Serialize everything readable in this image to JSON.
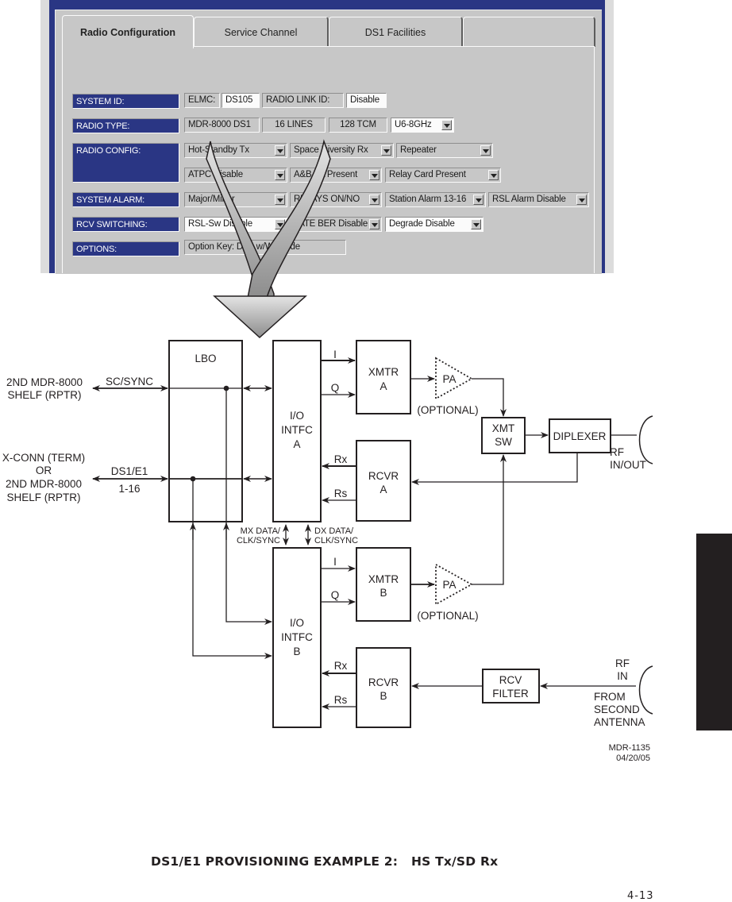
{
  "screenshot": {
    "tabs": [
      {
        "label": "Radio Configuration",
        "active": true
      },
      {
        "label": "Service Channel",
        "active": false
      },
      {
        "label": "DS1 Facilities",
        "active": false
      },
      {
        "label": "",
        "active": false
      }
    ],
    "rows": {
      "system_id": {
        "label": "SYSTEM ID:",
        "elmc_label": "ELMC:",
        "elmc_value": "DS105",
        "radio_link_label": "RADIO LINK ID:",
        "radio_link_value": "Disable"
      },
      "radio_type": {
        "label": "RADIO TYPE:",
        "model": "MDR-8000 DS1",
        "lines": "16 LINES",
        "modulation": "128 TCM",
        "band": "U6-8GHz"
      },
      "radio_config": {
        "label": "RADIO CONFIG:",
        "tx": "Hot-Standby Tx",
        "rx": "Space Diversity Rx",
        "mode": "Repeater",
        "atpc": "ATPC Disable",
        "aba": "A&B PA Present",
        "relay": "Relay Card Present"
      },
      "system_alarm": {
        "label": "SYSTEM ALARM:",
        "severity": "Major/Minor",
        "relays": "RELAYS ON/NO",
        "station": "Station Alarm 13-16",
        "rsl": "RSL Alarm Disable"
      },
      "rcv_switching": {
        "label": "RCV SWITCHING:",
        "rsl_sw": "RSL-Sw Disable",
        "ber": "LATE BER Disable",
        "degrade": "Degrade Disable"
      },
      "options": {
        "label": "OPTIONS:",
        "value": "Option Key: DS1 w/WaySide"
      }
    }
  },
  "diagram": {
    "blocks": {
      "lbo": "LBO",
      "io_a": [
        "I/O",
        "INTFC",
        "A"
      ],
      "io_b": [
        "I/O",
        "INTFC",
        "B"
      ],
      "xmtr_a": [
        "XMTR",
        "A"
      ],
      "xmtr_b": [
        "XMTR",
        "B"
      ],
      "rcvr_a": [
        "RCVR",
        "A"
      ],
      "rcvr_b": [
        "RCVR",
        "B"
      ],
      "pa": "PA",
      "xmt_sw": [
        "XMT",
        "SW"
      ],
      "diplexer": "DIPLEXER",
      "rcv_filter": [
        "RCV",
        "FILTER"
      ]
    },
    "labels": {
      "shelf_rptr_1": [
        "2ND MDR-8000",
        "SHELF (RPTR)"
      ],
      "sc_sync": "SC/SYNC",
      "xconn": [
        "X-CONN (TERM)",
        "OR",
        "2ND MDR-8000",
        "SHELF (RPTR)"
      ],
      "ds1_e1": "DS1/E1",
      "lines_range": "1-16",
      "i": "I",
      "q": "Q",
      "rx": "Rx",
      "rs": "Rs",
      "optional": "(OPTIONAL)",
      "mx_data": [
        "MX DATA/",
        "CLK/SYNC"
      ],
      "dx_data": [
        "DX DATA/",
        "CLK/SYNC"
      ],
      "rf_inout": [
        "RF",
        "IN/OUT"
      ],
      "rf_in": [
        "RF",
        "IN"
      ],
      "from_second": [
        "FROM",
        "SECOND",
        "ANTENNA"
      ],
      "drawing_id": [
        "MDR-1135",
        "04/20/05"
      ]
    }
  },
  "caption": "DS1/E1 PROVISIONING EXAMPLE 2:   HS Tx/SD Rx",
  "page_number": "4-13"
}
